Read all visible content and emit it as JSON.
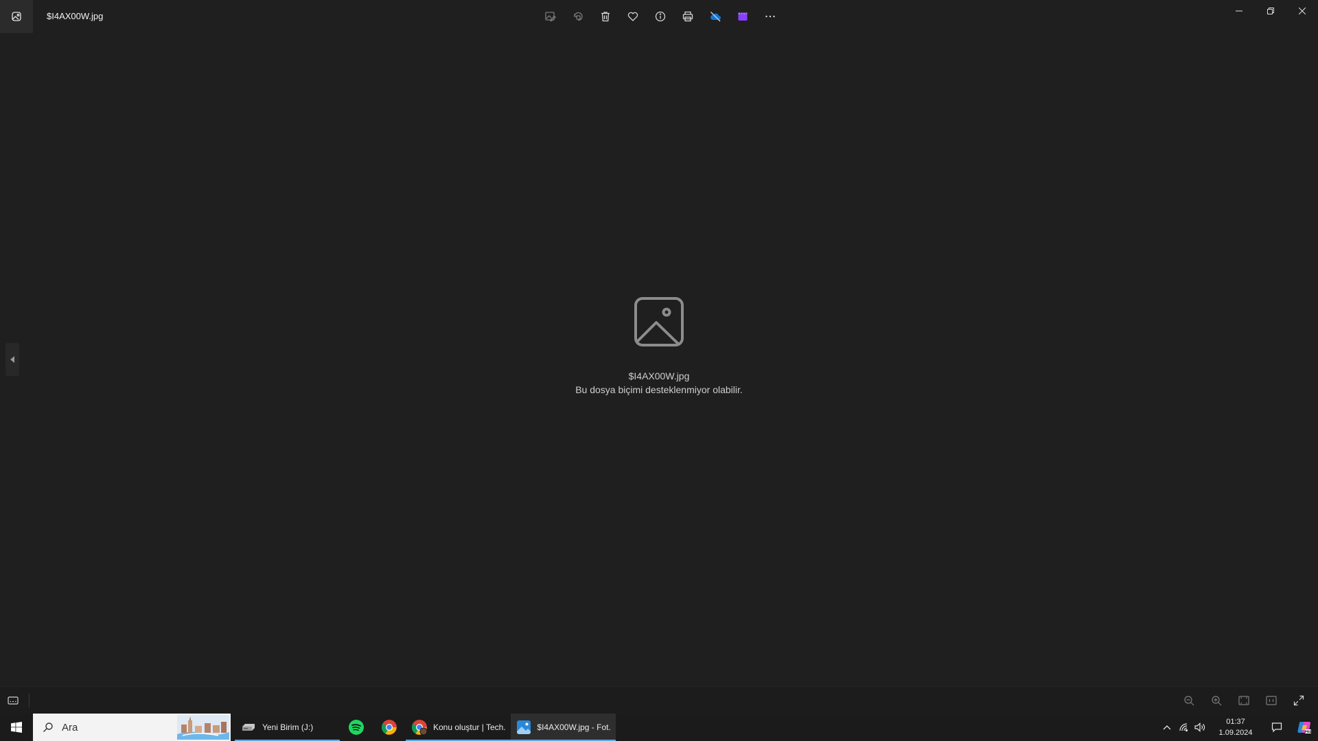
{
  "window": {
    "title": "$I4AX00W.jpg"
  },
  "toolbar": {
    "items": [
      {
        "name": "edit-image",
        "icon": "edit-image-icon",
        "enabled": false
      },
      {
        "name": "rotate",
        "icon": "rotate-icon",
        "enabled": false
      },
      {
        "name": "delete",
        "icon": "trash-icon",
        "enabled": true
      },
      {
        "name": "favorite",
        "icon": "heart-icon",
        "enabled": true
      },
      {
        "name": "info",
        "icon": "info-icon",
        "enabled": true
      },
      {
        "name": "print",
        "icon": "printer-icon",
        "enabled": true
      },
      {
        "name": "onedrive",
        "icon": "cloud-off-icon",
        "enabled": true
      },
      {
        "name": "clipchamp",
        "icon": "clapper-icon",
        "enabled": true
      },
      {
        "name": "more",
        "icon": "more-icon",
        "enabled": true
      }
    ]
  },
  "placeholder": {
    "filename": "$I4AX00W.jpg",
    "message": "Bu dosya biçimi desteklenmiyor olabilir."
  },
  "taskbar": {
    "search_placeholder": "Ara",
    "tasks": [
      {
        "label": "Yeni Birim (J:)",
        "icon": "drive-icon",
        "open": true,
        "active": false
      },
      {
        "label": "",
        "icon": "spotify-icon",
        "open": false,
        "active": false
      },
      {
        "label": "",
        "icon": "chrome-icon",
        "open": false,
        "active": false
      },
      {
        "label": "Konu oluştur | Tech...",
        "icon": "chrome-profile-icon",
        "open": true,
        "active": false
      },
      {
        "label": "$I4AX00W.jpg - Fot...",
        "icon": "photos-icon",
        "open": true,
        "active": true
      }
    ],
    "clock": {
      "time": "01:37",
      "date": "1.09.2024"
    }
  },
  "colors": {
    "background": "#1f1f1f",
    "accent": "#5aa9e6",
    "onedrive": "#0f78d4",
    "clipchamp": "#8a3ffc"
  }
}
